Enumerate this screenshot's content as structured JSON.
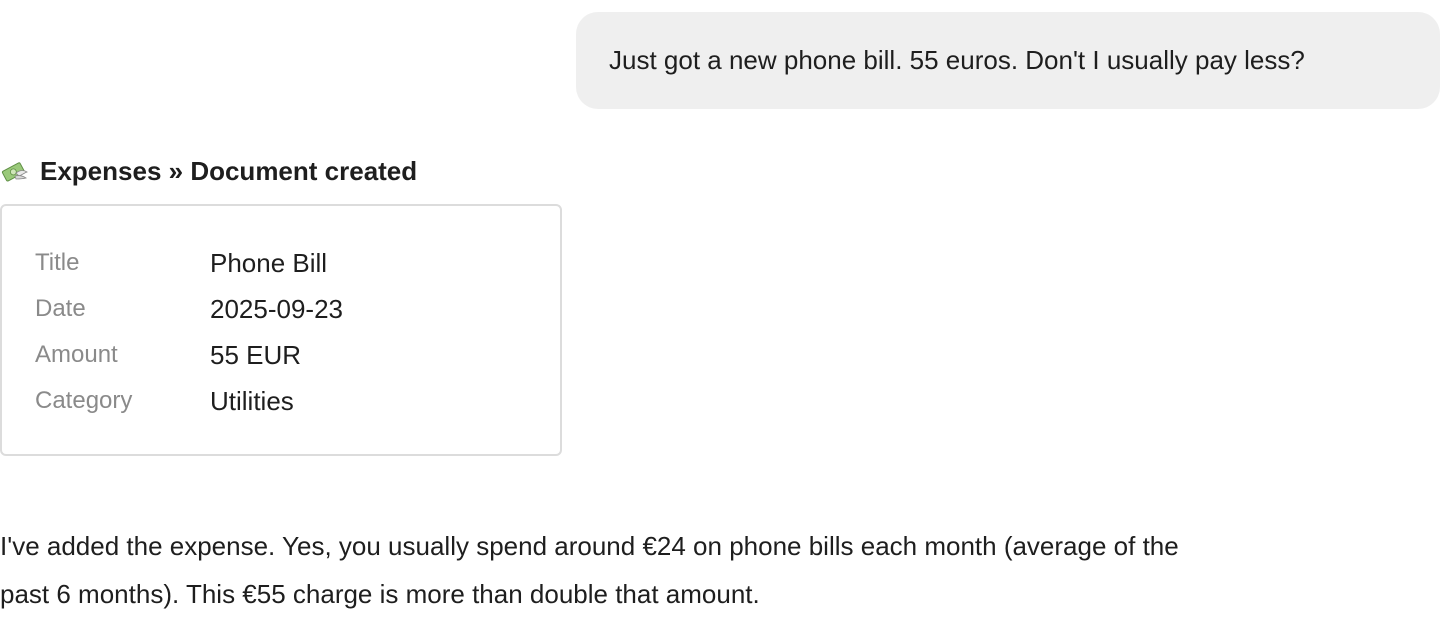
{
  "user_message": {
    "text": "Just got a new phone bill. 55 euros. Don't I usually pay less?"
  },
  "tool_call": {
    "icon": "money-with-wings-icon",
    "title": "Expenses » Document created"
  },
  "document": {
    "fields": [
      {
        "key": "Title",
        "value": "Phone Bill"
      },
      {
        "key": "Date",
        "value": "2025-09-23"
      },
      {
        "key": "Amount",
        "value": "55 EUR"
      },
      {
        "key": "Category",
        "value": "Utilities"
      }
    ]
  },
  "assistant_message": {
    "lines": [
      "I've added the expense. Yes, you usually spend around €24 on phone bills each month (average of the",
      "past 6 months). This €55 charge is more than double that amount."
    ]
  },
  "colors": {
    "user_bubble_bg": "#efefef",
    "card_border": "#dcdcdc",
    "label_gray": "#8a8a8a",
    "text": "#1e1e1e"
  }
}
